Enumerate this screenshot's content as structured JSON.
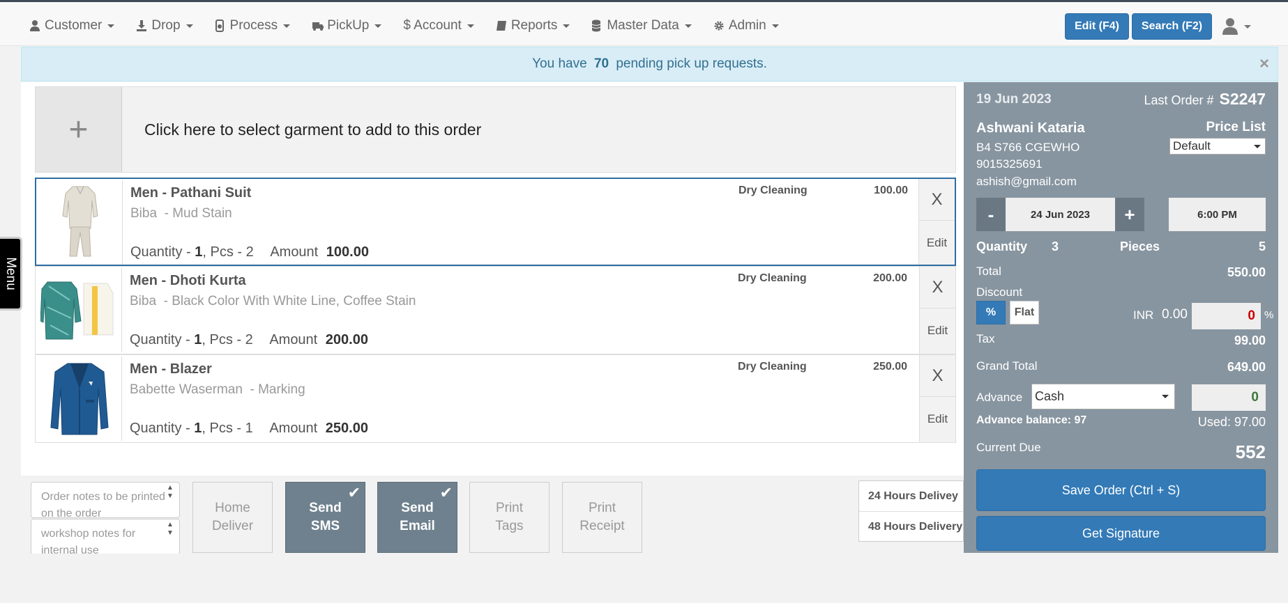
{
  "nav": {
    "items": [
      {
        "label": "Customer",
        "icon": "user-icon"
      },
      {
        "label": "Drop",
        "icon": "download-icon"
      },
      {
        "label": "Process",
        "icon": "process-icon"
      },
      {
        "label": "PickUp",
        "icon": "truck-icon"
      },
      {
        "label": "$ Account",
        "icon": "dollar-icon"
      },
      {
        "label": "Reports",
        "icon": "book-icon"
      },
      {
        "label": "Master Data",
        "icon": "database-icon"
      },
      {
        "label": "Admin",
        "icon": "gear-icon"
      }
    ],
    "edit_label": "Edit (F4)",
    "search_label": "Search (F2)"
  },
  "alert": {
    "prefix": "You have ",
    "count": "70",
    "suffix": " pending pick up requests.",
    "close": "×"
  },
  "add_garment": {
    "plus": "+",
    "text": "Click here to select garment to add to this order"
  },
  "menu_tab": "Menu",
  "order_items": [
    {
      "name": "Men - Pathani Suit",
      "desc": "Biba  - Mud Stain",
      "qty_label": "Quantity - ",
      "qty": "1",
      "pcs": ", Pcs - 2",
      "amount_label": "Amount ",
      "amount": "100.00",
      "service": "Dry Cleaning",
      "price": "100.00",
      "remove": "X",
      "edit": "Edit"
    },
    {
      "name": "Men - Dhoti Kurta",
      "desc": "Biba  - Black Color With White Line, Coffee Stain",
      "qty_label": "Quantity - ",
      "qty": "1",
      "pcs": ", Pcs - 2",
      "amount_label": "Amount ",
      "amount": "200.00",
      "service": "Dry Cleaning",
      "price": "200.00",
      "remove": "X",
      "edit": "Edit"
    },
    {
      "name": "Men - Blazer",
      "desc": "Babette Waserman  - Marking",
      "qty_label": "Quantity - ",
      "qty": "1",
      "pcs": ", Pcs - 1",
      "amount_label": "Amount ",
      "amount": "250.00",
      "service": "Dry Cleaning",
      "price": "250.00",
      "remove": "X",
      "edit": "Edit"
    }
  ],
  "notes": {
    "order_placeholder": "Order notes to be printed on the order",
    "workshop_placeholder": "workshop notes for internal use"
  },
  "tools": {
    "home_deliver": "Home Deliver",
    "send_sms": "Send SMS",
    "send_email": "Send Email",
    "print_tags": "Print Tags",
    "print_receipt": "Print Receipt",
    "check": "✔"
  },
  "delivery": [
    "24 Hours Delivey",
    "48 Hours Delivery"
  ],
  "panel": {
    "date": "19 Jun 2023",
    "last_order_label": "Last Order #",
    "last_order": "S2247",
    "customer_name": "Ashwani Kataria",
    "address": "B4 S766 CGEWHO",
    "phone": "9015325691",
    "email": "ashish@gmail.com",
    "price_list_label": "Price List",
    "price_list_value": "Default",
    "minus": "-",
    "plus": "+",
    "delivery_date": "24 Jun 2023",
    "delivery_time": "6:00 PM",
    "quantity_label": "Quantity",
    "quantity": "3",
    "pieces_label": "Pieces",
    "pieces": "5",
    "total_label": "Total",
    "total": "550.00",
    "discount_label": "Discount",
    "pct_btn": "%",
    "flat_btn": "Flat",
    "inr_label": "INR",
    "inr_value": "0.00",
    "discount_value": "0",
    "pct_sign": "%",
    "tax_label": "Tax",
    "tax": "99.00",
    "grand_total_label": "Grand Total",
    "grand_total": "649.00",
    "advance_label": "Advance",
    "advance_method": "Cash",
    "advance_value": "0",
    "advance_balance": "Advance balance: 97",
    "used": "Used: 97.00",
    "current_due_label": "Current Due",
    "current_due": "552",
    "save_label": "Save Order (Ctrl + S)",
    "signature_label": "Get Signature"
  },
  "colors": {
    "primary": "#337ab7",
    "panel": "#8795a0",
    "alert_bg": "#d9edf7",
    "alert_text": "#31708f",
    "active_tool": "#6f818e"
  }
}
